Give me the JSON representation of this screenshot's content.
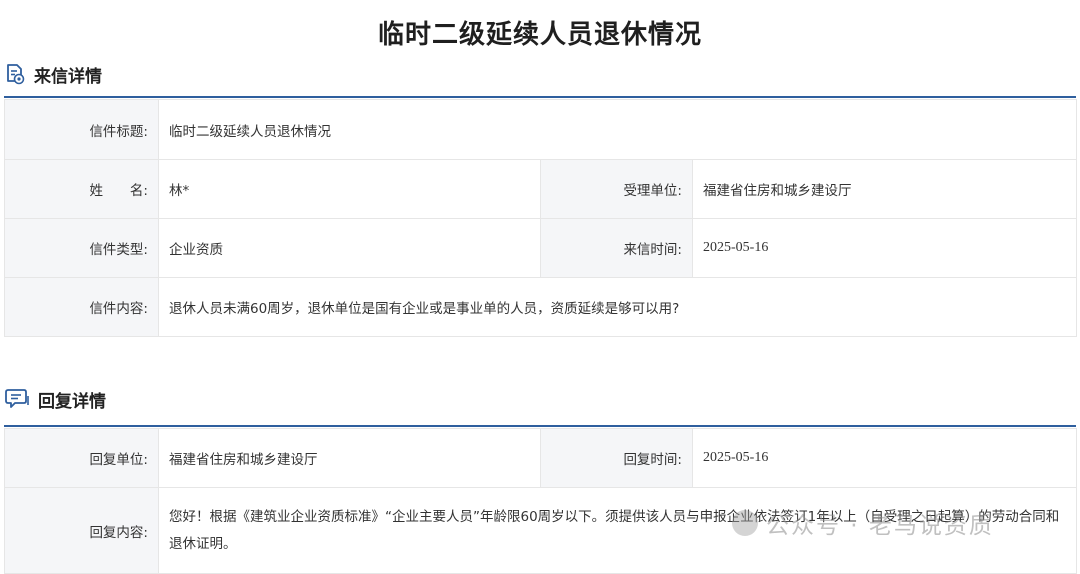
{
  "page": {
    "title": "临时二级延续人员退休情况"
  },
  "letter_section": {
    "heading": "来信详情",
    "icon": "document-eye-icon",
    "fields": {
      "subject_label": "信件标题:",
      "subject_value": "临时二级延续人员退休情况",
      "name_label": "姓　　名:",
      "name_value": "林*",
      "unit_label": "受理单位:",
      "unit_value": "福建省住房和城乡建设厅",
      "type_label": "信件类型:",
      "type_value": "企业资质",
      "time_label": "来信时间:",
      "time_value": "2025-05-16",
      "content_label": "信件内容:",
      "content_value": "退休人员未满60周岁，退休单位是国有企业或是事业单的人员，资质延续是够可以用?"
    }
  },
  "reply_section": {
    "heading": "回复详情",
    "icon": "chat-bubble-icon",
    "fields": {
      "unit_label": "回复单位:",
      "unit_value": "福建省住房和城乡建设厅",
      "time_label": "回复时间:",
      "time_value": "2025-05-16",
      "content_label": "回复内容:",
      "content_value": "您好！根据《建筑业企业资质标准》“企业主要人员”年龄限60周岁以下。须提供该人员与申报企业依法签订1年以上（自受理之日起算）的劳动合同和退休证明。"
    }
  },
  "watermark": {
    "text": "公众号 · 老马说资质"
  },
  "colors": {
    "accent": "#2f5f9e",
    "label_bg": "#f5f6f8",
    "border": "#e6e6e6"
  }
}
